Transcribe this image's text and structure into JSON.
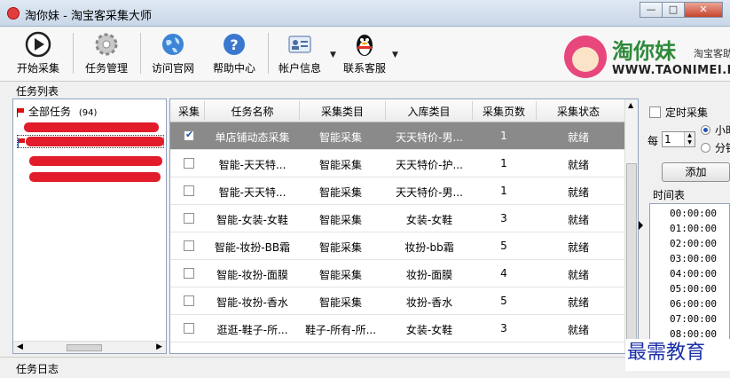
{
  "window": {
    "title": "淘你妹 - 淘宝客采集大师"
  },
  "toolbar": {
    "start": "开始采集",
    "tasks": "任务管理",
    "visit": "访问官网",
    "help": "帮助中心",
    "account": "帐户信息",
    "service": "联系客服"
  },
  "brand": {
    "name": "淘你妹",
    "sub": "淘宝客助",
    "url": "WWW.TAONIMEI.N"
  },
  "task_list_label": "任务列表",
  "tree": {
    "root": "全部任务",
    "count": "(94)"
  },
  "grid": {
    "headers": [
      "采集",
      "任务名称",
      "采集类目",
      "入库类目",
      "采集页数",
      "采集状态"
    ],
    "rows": [
      {
        "name": "单店铺动态采集",
        "cat": "智能采集",
        "store": "天天特价-男...",
        "pages": "1",
        "status": "就绪",
        "checked": true
      },
      {
        "name": "智能-天天特...",
        "cat": "智能采集",
        "store": "天天特价-护...",
        "pages": "1",
        "status": "就绪",
        "checked": false
      },
      {
        "name": "智能-天天特...",
        "cat": "智能采集",
        "store": "天天特价-男...",
        "pages": "1",
        "status": "就绪",
        "checked": false
      },
      {
        "name": "智能-女装-女鞋",
        "cat": "智能采集",
        "store": "女装-女鞋",
        "pages": "3",
        "status": "就绪",
        "checked": false
      },
      {
        "name": "智能-妆扮-BB霜",
        "cat": "智能采集",
        "store": "妆扮-bb霜",
        "pages": "5",
        "status": "就绪",
        "checked": false
      },
      {
        "name": "智能-妆扮-面膜",
        "cat": "智能采集",
        "store": "妆扮-面膜",
        "pages": "4",
        "status": "就绪",
        "checked": false
      },
      {
        "name": "智能-妆扮-香水",
        "cat": "智能采集",
        "store": "妆扮-香水",
        "pages": "5",
        "status": "就绪",
        "checked": false
      },
      {
        "name": "逛逛-鞋子-所...",
        "cat": "鞋子-所有-所...",
        "store": "女装-女鞋",
        "pages": "3",
        "status": "就绪",
        "checked": false
      }
    ]
  },
  "schedule": {
    "timer_label": "定时采集",
    "every": "每",
    "every_value": "1",
    "unit_hour": "小时",
    "unit_min": "分钟",
    "add": "添加",
    "timetable_label": "时间表",
    "times": [
      "00:00:00",
      "01:00:00",
      "02:00:00",
      "03:00:00",
      "04:00:00",
      "05:00:00",
      "06:00:00",
      "07:00:00",
      "08:00:00"
    ]
  },
  "log_label": "任务日志",
  "watermark": "最需教育"
}
